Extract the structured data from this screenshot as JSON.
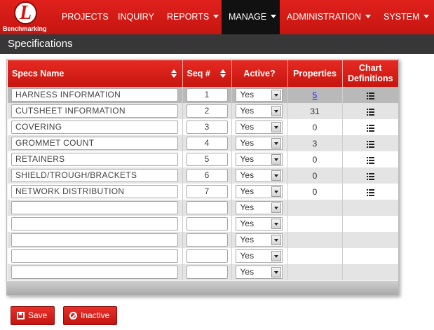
{
  "app": {
    "logo_letter": "L",
    "logo_text": "Benchmarking"
  },
  "nav": [
    {
      "label": "PROJECTS",
      "dropdown": false,
      "active": false
    },
    {
      "label": "INQUIRY",
      "dropdown": false,
      "active": false
    },
    {
      "label": "REPORTS",
      "dropdown": true,
      "active": false
    },
    {
      "label": "MANAGE",
      "dropdown": true,
      "active": true
    },
    {
      "label": "ADMINISTRATION",
      "dropdown": true,
      "active": false
    },
    {
      "label": "SYSTEM",
      "dropdown": true,
      "active": false
    }
  ],
  "page": {
    "title": "Specifications"
  },
  "grid": {
    "columns": {
      "name": "Specs Name",
      "seq": "Seq #",
      "active": "Active?",
      "properties": "Properties",
      "chart_line1": "Chart",
      "chart_line2": "Definitions"
    },
    "rows": [
      {
        "name": "HARNESS INFORMATION",
        "seq": "1",
        "active": "Yes",
        "properties": "5",
        "properties_link": true,
        "chart_icon": "list-icon",
        "selected": true
      },
      {
        "name": "CUTSHEET INFORMATION",
        "seq": "2",
        "active": "Yes",
        "properties": "31",
        "properties_link": false,
        "chart_icon": "list-icon"
      },
      {
        "name": "COVERING",
        "seq": "3",
        "active": "Yes",
        "properties": "0",
        "properties_link": false,
        "chart_icon": "list-icon"
      },
      {
        "name": "GROMMET COUNT",
        "seq": "4",
        "active": "Yes",
        "properties": "3",
        "properties_link": false,
        "chart_icon": "list-icon"
      },
      {
        "name": "RETAINERS",
        "seq": "5",
        "active": "Yes",
        "properties": "0",
        "properties_link": false,
        "chart_icon": "list-icon"
      },
      {
        "name": "SHIELD/TROUGH/BRACKETS",
        "seq": "6",
        "active": "Yes",
        "properties": "0",
        "properties_link": false,
        "chart_icon": "list-icon"
      },
      {
        "name": "NETWORK DISTRIBUTION",
        "seq": "7",
        "active": "Yes",
        "properties": "0",
        "properties_link": false,
        "chart_icon": "list-icon"
      },
      {
        "name": "",
        "seq": "",
        "active": "Yes",
        "properties": "",
        "chart_icon": ""
      },
      {
        "name": "",
        "seq": "",
        "active": "Yes",
        "properties": "",
        "chart_icon": ""
      },
      {
        "name": "",
        "seq": "",
        "active": "Yes",
        "properties": "",
        "chart_icon": ""
      },
      {
        "name": "",
        "seq": "",
        "active": "Yes",
        "properties": "",
        "chart_icon": ""
      },
      {
        "name": "",
        "seq": "",
        "active": "Yes",
        "properties": "",
        "chart_icon": ""
      }
    ]
  },
  "actions": {
    "save_label": "Save",
    "save_icon": "save-icon",
    "inactive_label": "Inactive",
    "inactive_icon": "ban-icon"
  },
  "colors": {
    "brand_red": "#d3140f",
    "nav_active_bg": "#111111",
    "title_bar_bg": "#373737",
    "link": "#1a1aff"
  }
}
